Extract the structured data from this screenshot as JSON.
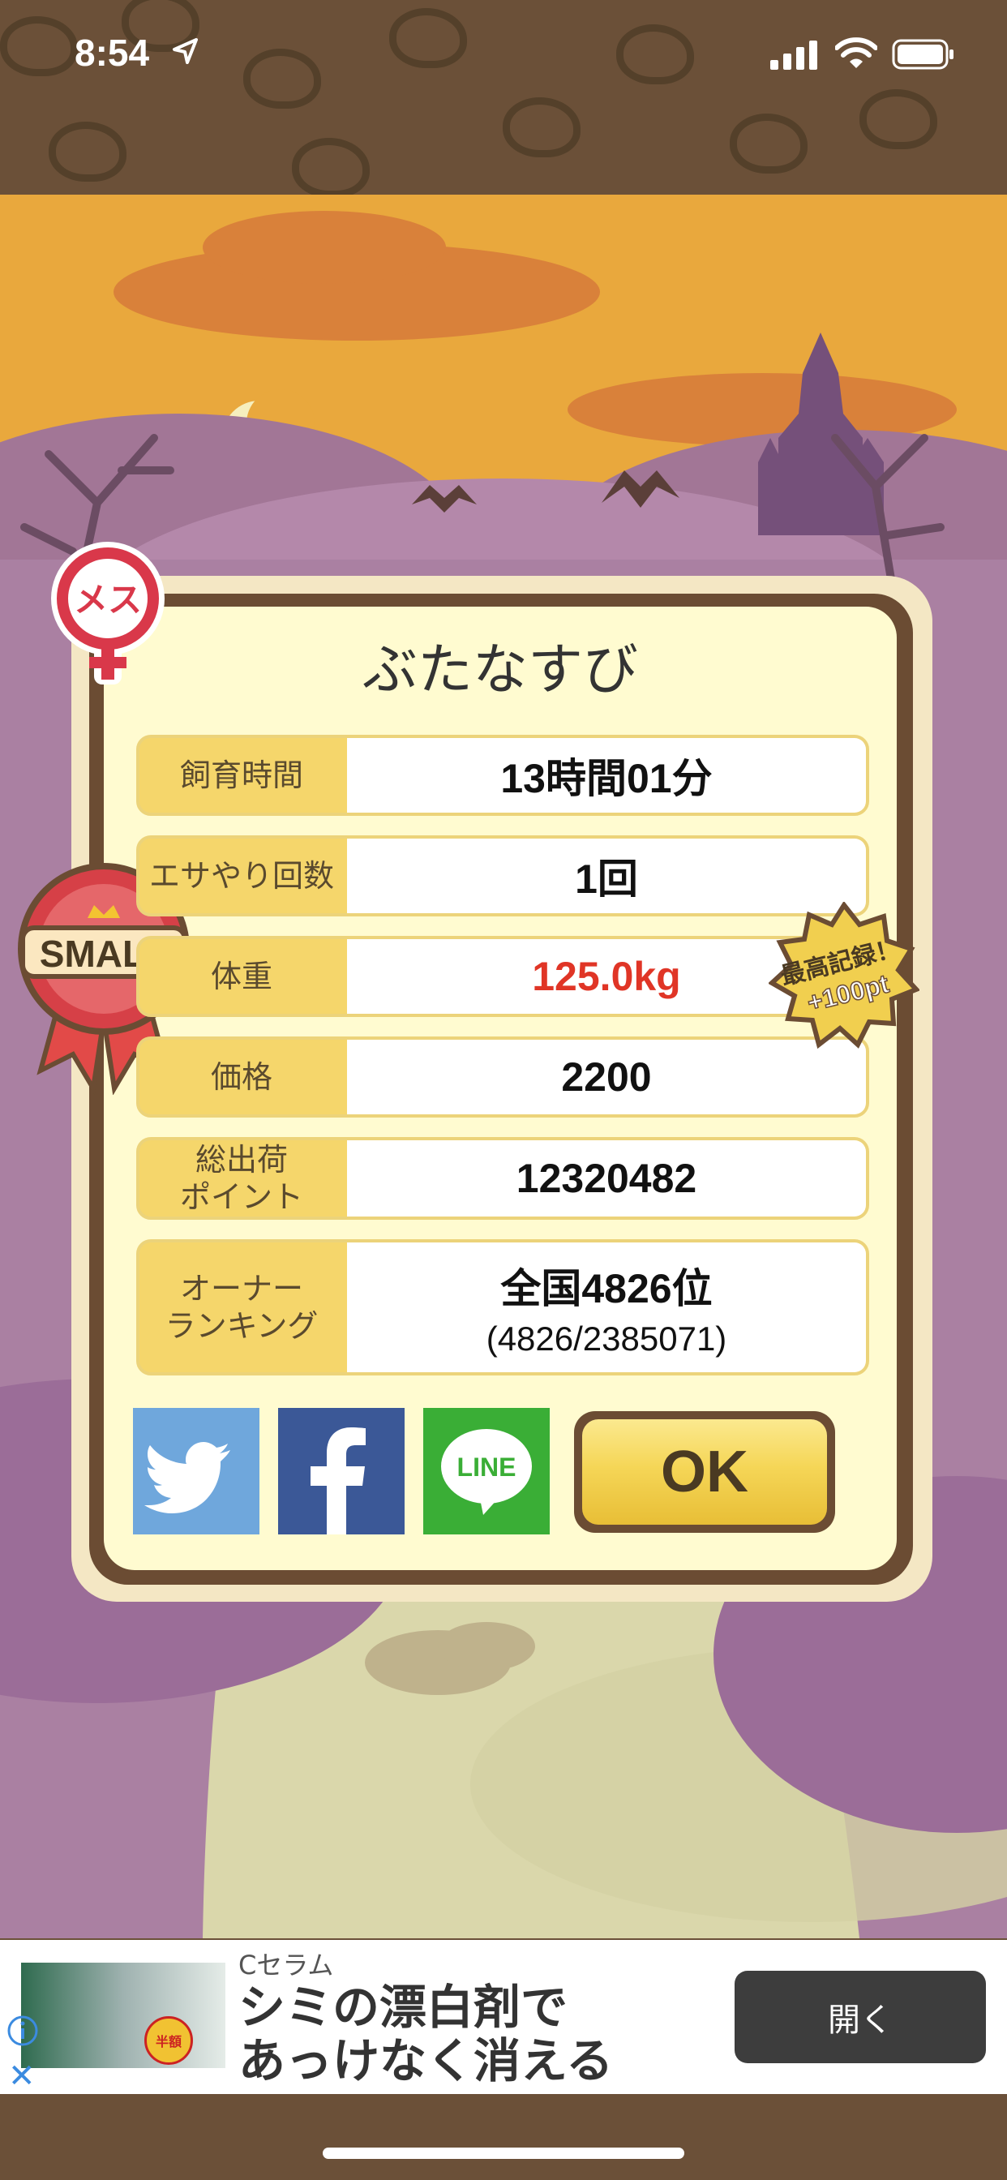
{
  "status": {
    "time": "8:54"
  },
  "dialog": {
    "title": "ぶたなすび",
    "gender_badge": "メス",
    "size_badge": "SMALL",
    "record_badge": {
      "line1": "最高記録！",
      "line2": "+100pt"
    },
    "rows": [
      {
        "label": "飼育時間",
        "value": "13時間01分"
      },
      {
        "label": "エサやり回数",
        "value": "1回"
      },
      {
        "label": "体重",
        "value": "125.0kg"
      },
      {
        "label": "価格",
        "value": "2200"
      },
      {
        "label": "総出荷\nポイント",
        "value": "12320482"
      },
      {
        "label": "オーナー\nランキング",
        "value": "全国4826位",
        "sub": "(4826/2385071)"
      }
    ],
    "share": {
      "line_label": "LINE"
    },
    "ok_label": "OK"
  },
  "ad": {
    "brand": "Cセラム",
    "headline": "シミの漂白剤で\nあっけなく消える",
    "open_label": "開く",
    "sale_badge": "半額"
  },
  "colors": {
    "twitter": "#6fa7dc",
    "facebook": "#3b5897",
    "line": "#3aae36",
    "value_red": "#e03526",
    "label_bg": "#f5d66b"
  }
}
